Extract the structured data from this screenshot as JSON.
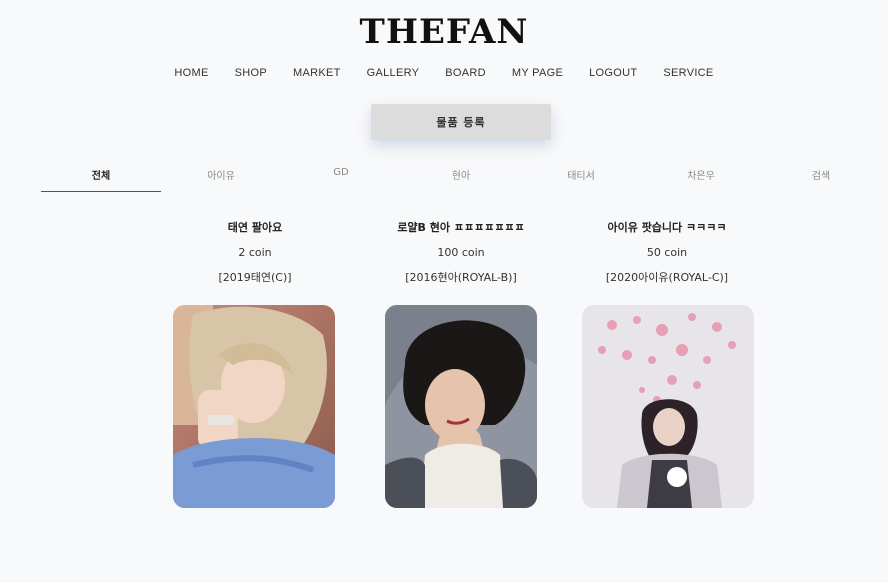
{
  "brand": {
    "logo": "THEFAN"
  },
  "nav": [
    "HOME",
    "SHOP",
    "MARKET",
    "GALLERY",
    "BOARD",
    "MY PAGE",
    "LOGOUT",
    "SERVICE"
  ],
  "register_button": "물품 등록",
  "tabs": [
    "전체",
    "아이유",
    "GD",
    "현아",
    "태티서",
    "차은우",
    "검색"
  ],
  "active_tab": "전체",
  "accent_color": "#c2185b",
  "items": [
    {
      "title": "태연 팔아요",
      "price": "2 coin",
      "tag": "[2019태연(C)]",
      "image": "photo-taeyeon"
    },
    {
      "title": "로얄B 현아 ㅍㅍㅍㅍㅍㅍㅍ",
      "price": "100 coin",
      "tag": "[2016현아(ROYAL-B)]",
      "image": "photo-hyuna"
    },
    {
      "title": "아이유 팟습니다 ㅋㅋㅋㅋ",
      "price": "50 coin",
      "tag": "[2020아이유(ROYAL-C)]",
      "image": "photo-iu"
    }
  ]
}
